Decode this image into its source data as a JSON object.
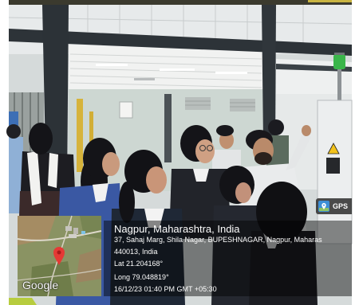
{
  "gps_badge": {
    "label": "GPS",
    "icon": "map-pin-icon"
  },
  "map": {
    "logo_text": "Google",
    "pin_icon": "location-pin-icon"
  },
  "location": {
    "title": "Nagpur, Maharashtra, India",
    "address": "37, Sahaj Marg, Shila Nagar, BUPESHNAGAR, Nagpur, Maharas",
    "postal": "440013, India",
    "latitude": "Lat 21.204168°",
    "longitude": "Long 79.048819°",
    "timestamp": "16/12/23 01:40 PM GMT +05:30"
  },
  "colors": {
    "map_pin": "#e53935",
    "signal_light": "#3ab54a",
    "gps_icon": "#3d8fd6"
  }
}
